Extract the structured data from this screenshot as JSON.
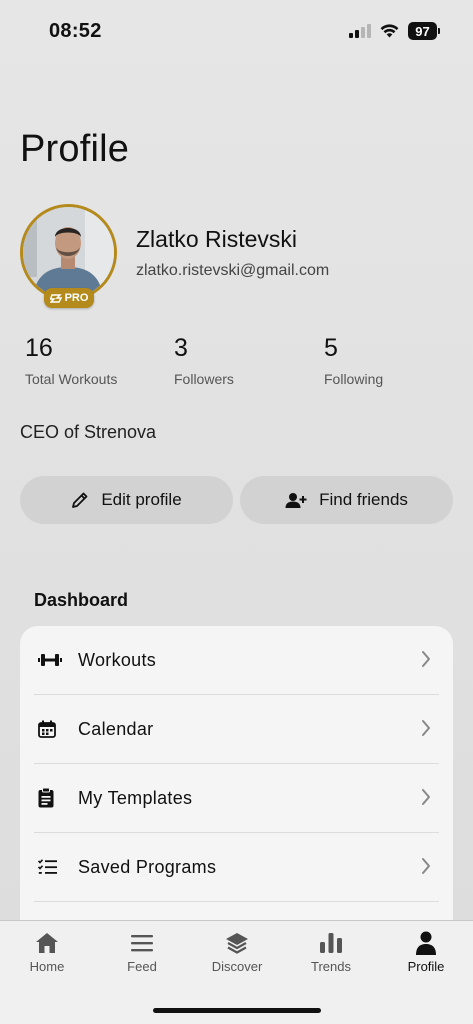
{
  "status_bar": {
    "time": "08:52",
    "battery": "97"
  },
  "page_title": "Profile",
  "profile": {
    "name": "Zlatko Ristevski",
    "email": "zlatko.ristevski@gmail.com",
    "badge": "PRO",
    "bio": "CEO of Strenova"
  },
  "stats": [
    {
      "value": "16",
      "label": "Total Workouts"
    },
    {
      "value": "3",
      "label": "Followers"
    },
    {
      "value": "5",
      "label": "Following"
    }
  ],
  "actions": {
    "edit_label": "Edit profile",
    "find_label": "Find friends"
  },
  "dashboard": {
    "title": "Dashboard",
    "items": [
      {
        "label": "Workouts",
        "icon": "dumbbell-icon"
      },
      {
        "label": "Calendar",
        "icon": "calendar-icon"
      },
      {
        "label": "My Templates",
        "icon": "clipboard-icon"
      },
      {
        "label": "Saved Programs",
        "icon": "checklist-icon"
      }
    ]
  },
  "tabs": [
    {
      "label": "Home",
      "icon": "home-icon"
    },
    {
      "label": "Feed",
      "icon": "menu-icon"
    },
    {
      "label": "Discover",
      "icon": "layers-icon"
    },
    {
      "label": "Trends",
      "icon": "bar-chart-icon"
    },
    {
      "label": "Profile",
      "icon": "person-icon",
      "active": true
    }
  ],
  "colors": {
    "accent_gold": "#b58a1c",
    "button_bg": "#d2d2d2",
    "card_bg": "#f5f5f5"
  }
}
